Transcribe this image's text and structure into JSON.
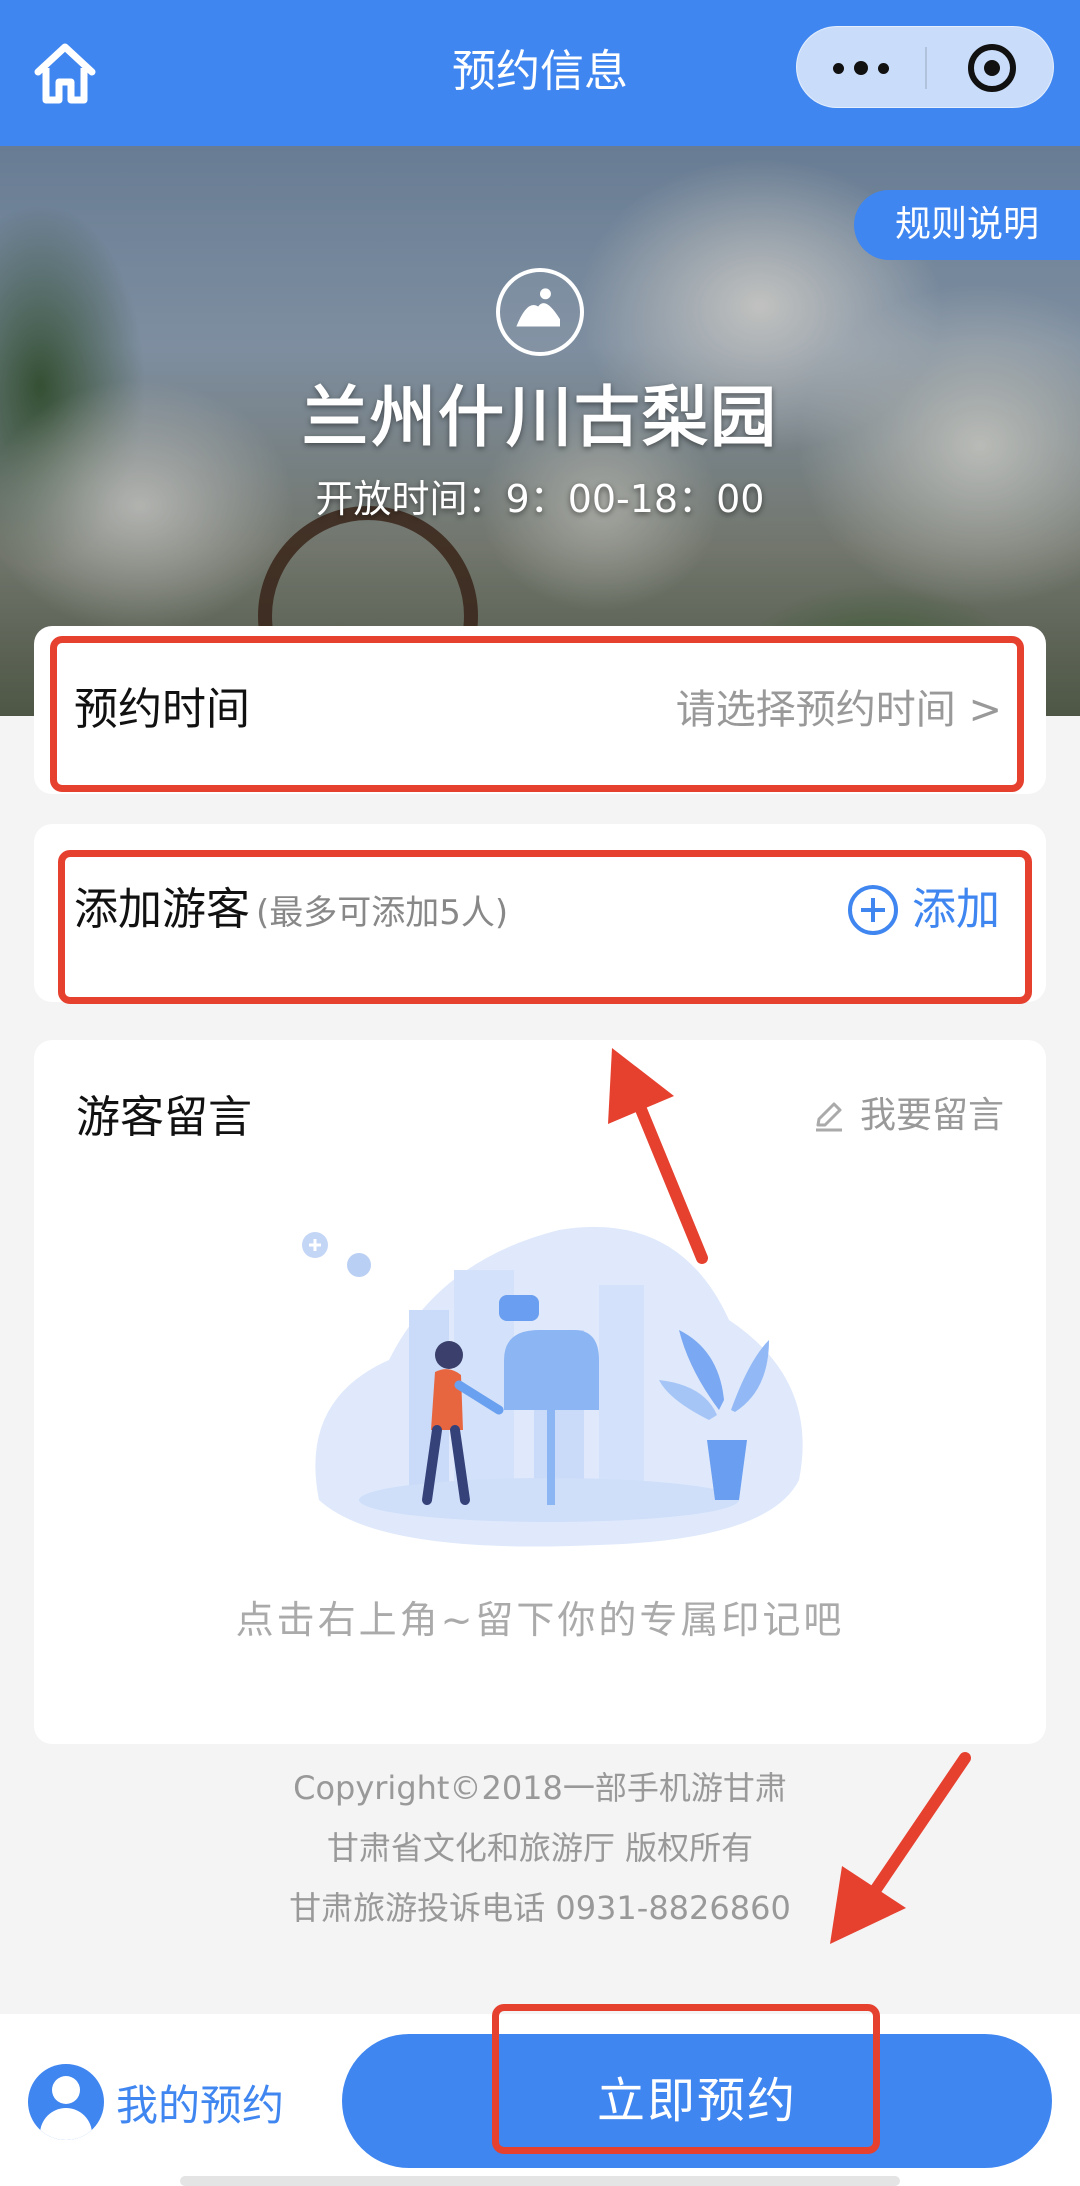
{
  "nav": {
    "title": "预约信息"
  },
  "hero": {
    "rules_label": "规则说明",
    "title": "兰州什川古梨园",
    "hours": "开放时间：9：00-18：00"
  },
  "reservation_time": {
    "label": "预约时间",
    "placeholder": "请选择预约时间 >"
  },
  "add_visitor": {
    "label": "添加游客",
    "note": "(最多可添加5人)",
    "button_label": "添加"
  },
  "messages": {
    "title": "游客留言",
    "write_label": "我要留言",
    "empty_text": "点击右上角~留下你的专属印记吧"
  },
  "footer": {
    "copyright": "Copyright©2018一部手机游甘肃",
    "owner": "甘肃省文化和旅游厅 版权所有",
    "complaint": "甘肃旅游投诉电话 0931-8826860"
  },
  "bottom": {
    "my_reservations": "我的预约",
    "book_now": "立即预约"
  },
  "icons": [
    "home-icon",
    "more-icon",
    "target-icon",
    "scenic-logo-icon",
    "plus-circle-icon",
    "pencil-icon",
    "avatar-icon"
  ],
  "colors": {
    "accent": "#3f86f1",
    "annotation": "#e6402f",
    "background": "#f4f4f4"
  }
}
